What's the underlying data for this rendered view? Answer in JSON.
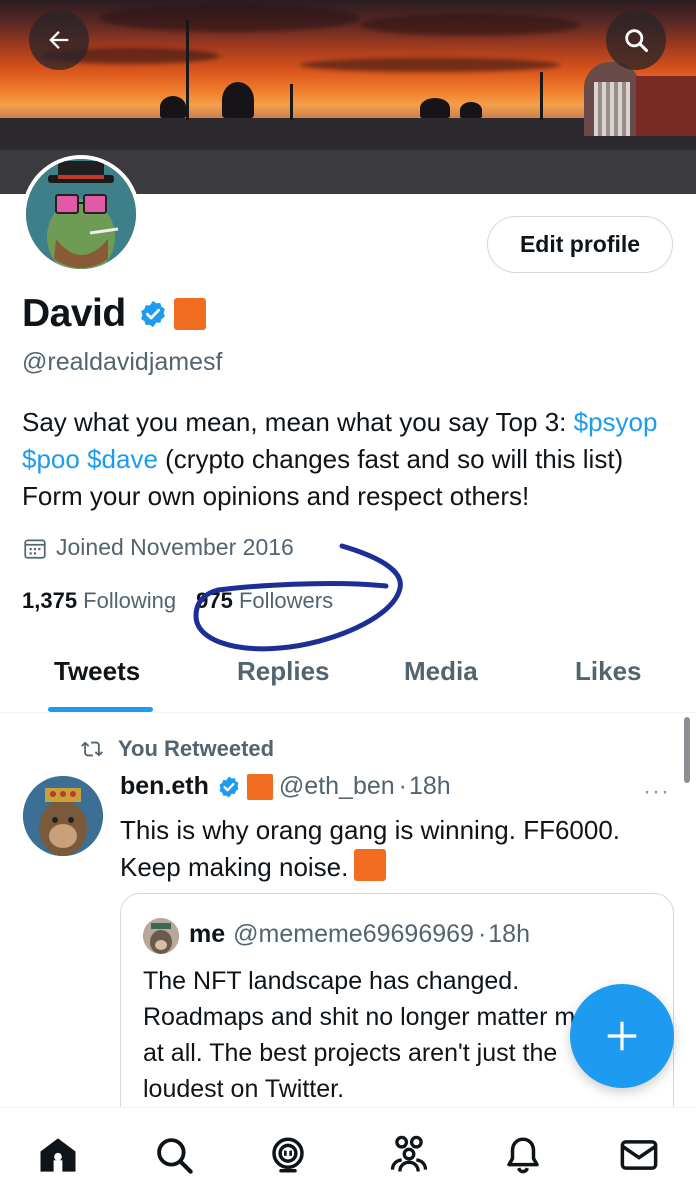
{
  "header": {
    "back_icon": "arrow-left-icon",
    "search_icon": "search-icon"
  },
  "profile": {
    "name": "David",
    "handle": "@realdavidjamesf",
    "edit_label": "Edit profile",
    "bio_part1": "Say what you mean, mean what you say Top 3: ",
    "bio_cashtags": "$psyop $poo $dave",
    "bio_part2": " (crypto changes fast and so will this list) Form your own opinions and respect others!",
    "joined": "Joined November 2016",
    "following_count": "1,375",
    "following_label": " Following",
    "followers_count": "975",
    "followers_label": " Followers",
    "accent_color": "#1d9bf0",
    "badge_color": "#f26d22"
  },
  "tabs": [
    {
      "label": "Tweets",
      "active": true
    },
    {
      "label": "Replies",
      "active": false
    },
    {
      "label": "Media",
      "active": false
    },
    {
      "label": "Likes",
      "active": false
    }
  ],
  "tweet": {
    "retweet_label": "You Retweeted",
    "author_name": "ben.eth",
    "author_handle": "@eth_ben",
    "separator": "·",
    "time": "18h",
    "more": "···",
    "text": "This is why orang gang is winning. FF6000. Keep making noise.",
    "quote": {
      "author_name": "me",
      "author_handle": "@mememe69696969",
      "separator": "·",
      "time": "18h",
      "text": "The NFT landscape has changed. Roadmaps and shit no longer matter much, if at all. The best projects aren't just the loudest on Twitter."
    }
  },
  "fab": {
    "icon": "plus-icon"
  },
  "bottom_nav": [
    {
      "icon": "home-icon"
    },
    {
      "icon": "search-icon"
    },
    {
      "icon": "spaces-icon"
    },
    {
      "icon": "communities-icon"
    },
    {
      "icon": "bell-icon"
    },
    {
      "icon": "mail-icon"
    }
  ]
}
